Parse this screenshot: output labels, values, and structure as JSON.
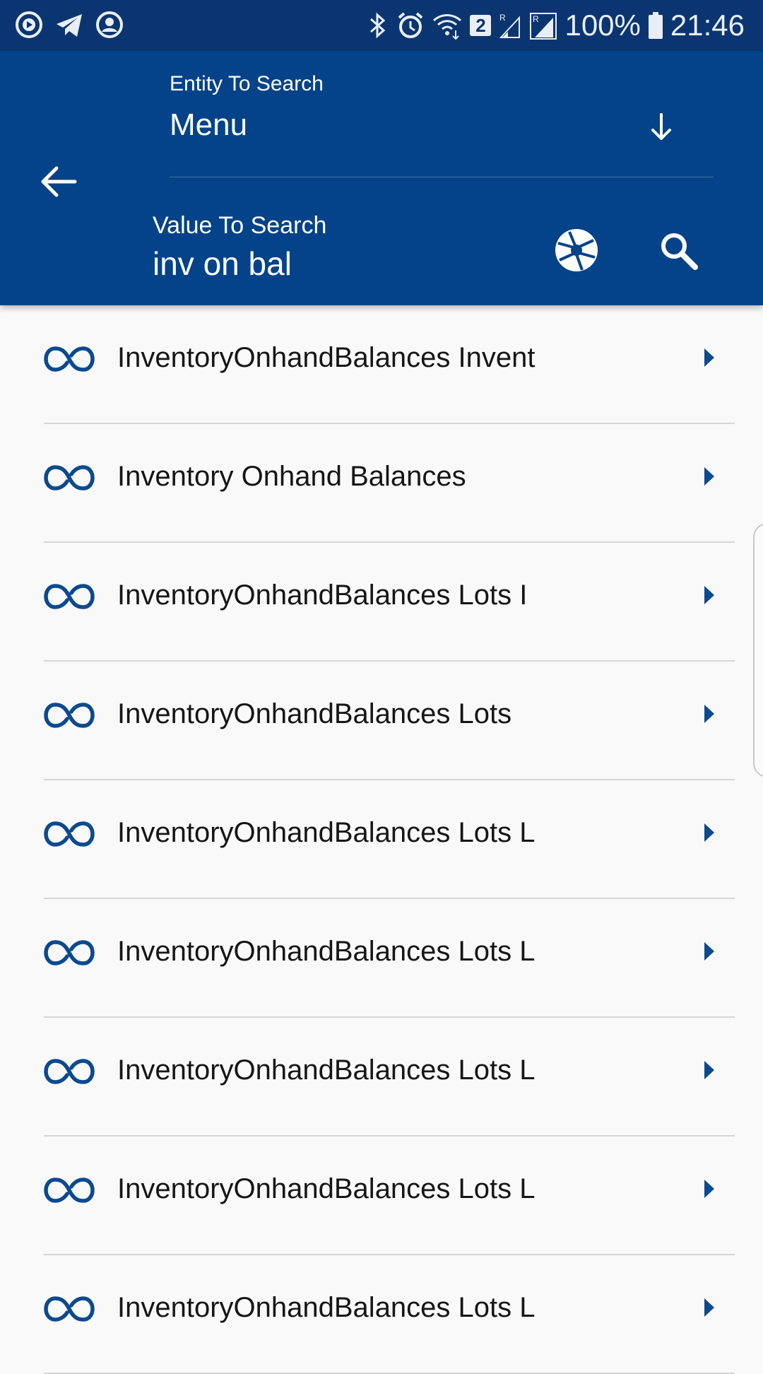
{
  "status_bar": {
    "battery": "100%",
    "time": "21:46",
    "notification_count": "2"
  },
  "header": {
    "entity_label": "Entity To Search",
    "entity_value": "Menu",
    "value_label": "Value To Search",
    "value_text": "inv on bal"
  },
  "results": [
    {
      "label": "InventoryOnhandBalances Invent"
    },
    {
      "label": "Inventory Onhand Balances"
    },
    {
      "label": "InventoryOnhandBalances Lots I"
    },
    {
      "label": "InventoryOnhandBalances Lots"
    },
    {
      "label": "InventoryOnhandBalances Lots L"
    },
    {
      "label": "InventoryOnhandBalances Lots L"
    },
    {
      "label": "InventoryOnhandBalances Lots L"
    },
    {
      "label": "InventoryOnhandBalances Lots L"
    },
    {
      "label": "InventoryOnhandBalances Lots L"
    }
  ],
  "colors": {
    "status_bar": "#0a3570",
    "header": "#044389",
    "accent": "#0b4a90",
    "background": "#f9f9fa"
  },
  "icons": {
    "back": "arrow-left-icon",
    "dropdown": "arrow-down-icon",
    "camera": "camera-shutter-icon",
    "search": "search-icon",
    "item": "link-infinity-icon",
    "item_arrow": "chevron-right-icon"
  }
}
